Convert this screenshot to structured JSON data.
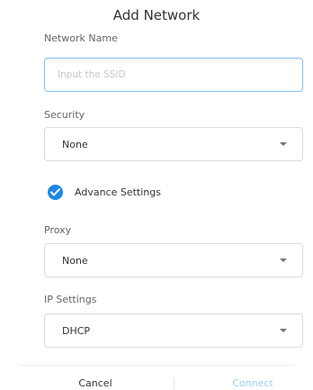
{
  "dialog": {
    "title": "Add Network"
  },
  "network_name": {
    "label": "Network Name",
    "value": "",
    "placeholder": "Input the SSID"
  },
  "security": {
    "label": "Security",
    "selected": "None"
  },
  "advance_settings": {
    "label": "Advance Settings",
    "checked": true
  },
  "proxy": {
    "label": "Proxy",
    "selected": "None"
  },
  "ip_settings": {
    "label": "IP Settings",
    "selected": "DHCP"
  },
  "footer": {
    "cancel_label": "Cancel",
    "connect_label": "Connect"
  },
  "icons": {
    "checkbox": "check-circle-icon",
    "dropdown": "caret-down-icon"
  },
  "colors": {
    "accent": "#1e88e5",
    "input_focus_border": "#7fc0ee",
    "connect_disabled": "#9ccdf2"
  }
}
